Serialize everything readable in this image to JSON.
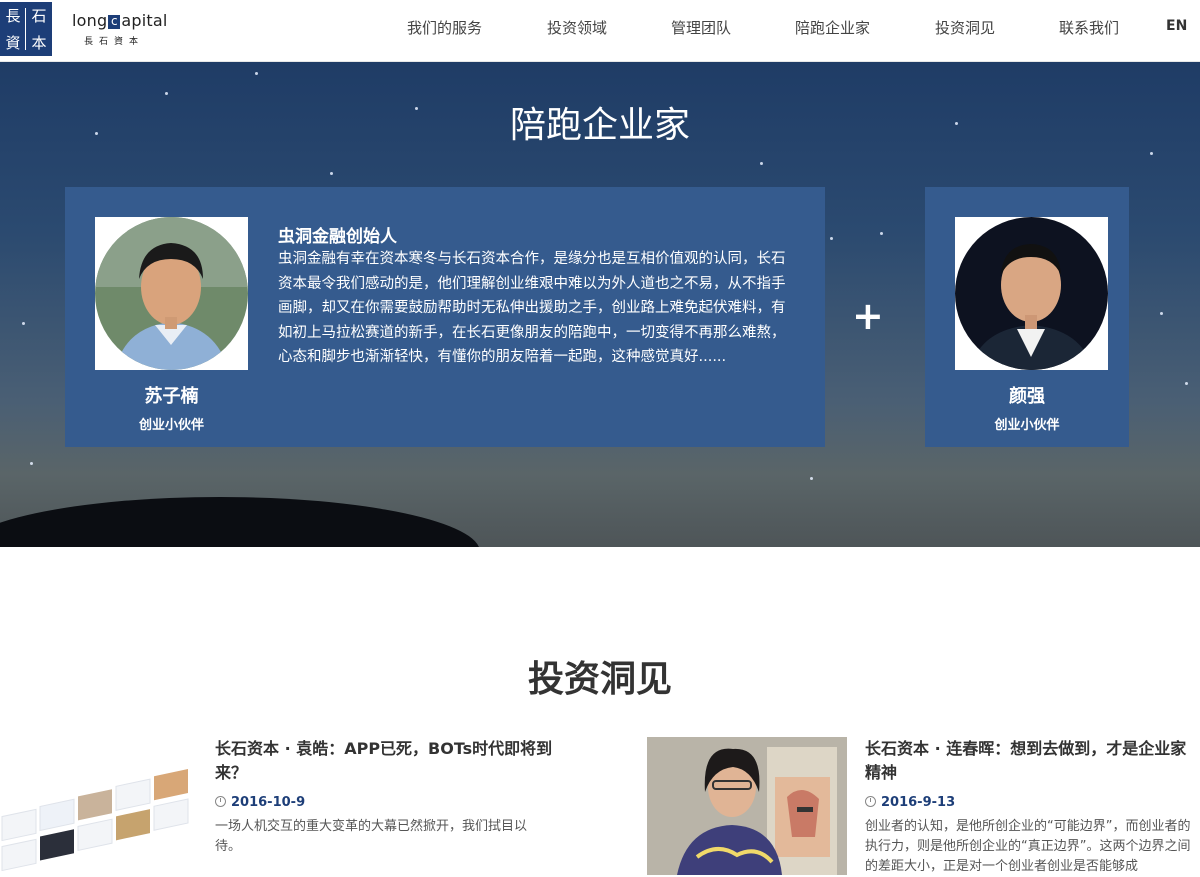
{
  "header": {
    "logo_chars": [
      "長",
      "石",
      "資",
      "本"
    ],
    "logo_text_pre": "long",
    "logo_text_c": "c",
    "logo_text_post": "apital",
    "logo_sub": "長石資本",
    "nav": [
      "我们的服务",
      "投资领域",
      "管理团队",
      "陪跑企业家",
      "投资洞见",
      "联系我们"
    ],
    "lang": "EN"
  },
  "hero": {
    "title": "陪跑企业家",
    "main_card": {
      "name": "苏子楠",
      "role": "创业小伙伴",
      "quote_title": "虫洞金融创始人",
      "quote_text": "虫洞金融有幸在资本寒冬与长石资本合作，是缘分也是互相价值观的认同，长石资本最令我们感动的是，他们理解创业维艰中难以为外人道也之不易，从不指手画脚，却又在你需要鼓励帮助时无私伸出援助之手，创业路上难免起伏难料，有如初上马拉松赛道的新手，在长石更像朋友的陪跑中，一切变得不再那么难熬，心态和脚步也渐渐轻快，有懂你的朋友陪着一起跑，这种感觉真好......"
    },
    "plus": "+",
    "side_card": {
      "name": "颜强",
      "role": "创业小伙伴"
    }
  },
  "insights": {
    "title": "投资洞见",
    "articles": [
      {
        "title": "长石资本 · 袁皓：APP已死，BOTs时代即将到来？",
        "date": "2016-10-9",
        "desc": "一场人机交互的重大变革的大幕已然掀开，我们拭目以待。"
      },
      {
        "title": "长石资本 · 连春晖：想到去做到，才是企业家精神",
        "date": "2016-9-13",
        "desc": "创业者的认知，是他所创企业的“可能边界”，而创业者的执行力，则是他所创企业的“真正边界”。这两个边界之间的差距大小，正是对一个创业者创业是否能够成"
      }
    ]
  }
}
